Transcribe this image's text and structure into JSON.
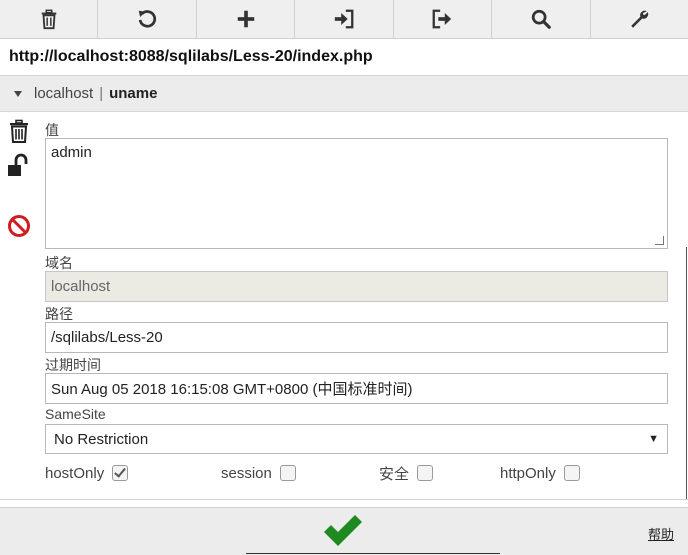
{
  "toolbar": {
    "buttons": [
      {
        "icon": "trash-icon"
      },
      {
        "icon": "reset-icon"
      },
      {
        "icon": "add-icon"
      },
      {
        "icon": "import-icon"
      },
      {
        "icon": "export-icon"
      },
      {
        "icon": "search-icon"
      },
      {
        "icon": "wrench-icon"
      }
    ]
  },
  "url": "http://localhost:8088/sqlilabs/Less-20/index.php",
  "cookie": {
    "domain": "localhost",
    "separator": "|",
    "name": "uname"
  },
  "form": {
    "value_label": "值",
    "value": "admin",
    "domain_label": "域名",
    "domain": "localhost",
    "path_label": "路径",
    "path": "/sqlilabs/Less-20",
    "expires_label": "过期时间",
    "expires": "Sun Aug 05 2018 16:15:08 GMT+0800 (中国标准时间)",
    "samesite_label": "SameSite",
    "samesite": "No Restriction",
    "hostonly_label": "hostOnly",
    "hostonly_checked": true,
    "session_label": "session",
    "session_checked": false,
    "secure_label": "安全",
    "secure_checked": false,
    "httponly_label": "httpOnly",
    "httponly_checked": false
  },
  "footer": {
    "help_label": "帮助"
  },
  "colors": {
    "save_green": "#1f8a1f",
    "block_red": "#d01c1c"
  }
}
